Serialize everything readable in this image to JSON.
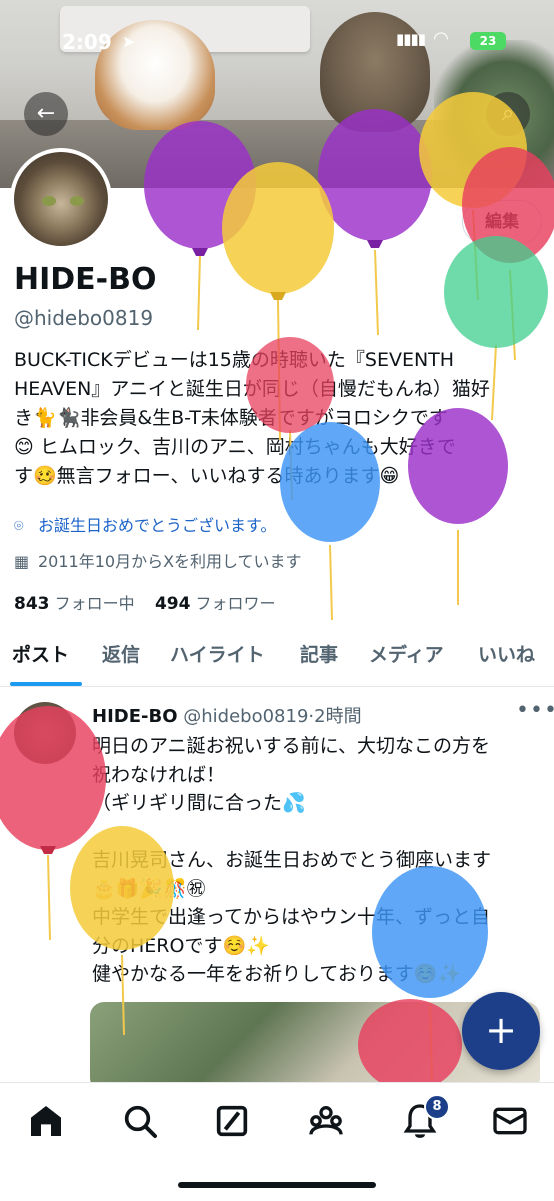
{
  "status_bar": {
    "time": "2:09",
    "battery": "23"
  },
  "profile": {
    "name": "HIDE-BO",
    "handle": "@hidebo0819",
    "edit_label": "編集",
    "bio": [
      "BUCK-TICKデビューは15歳の時聴いた『SEVENTH",
      "HEAVEN』アニイと誕生日が同じ（自慢だもんね）猫好",
      "き🐈🐈‍⬛非会員&生B-T未体験者ですがヨロシクです",
      "😊 ヒムロック、吉川のアニ、岡村ちゃんも大好きで",
      "す🥴無言フォロー、いいねする時あります😁"
    ],
    "birthday": "お誕生日おめでとうございます。",
    "joined": "2011年10月からXを利用しています",
    "following_count": "843",
    "following_label": "フォロー中",
    "followers_count": "494",
    "followers_label": "フォロワー"
  },
  "tabs": [
    "ポスト",
    "返信",
    "ハイライト",
    "記事",
    "メディア",
    "いいね"
  ],
  "post": {
    "name": "HIDE-BO",
    "handle": "@hidebo0819",
    "time": "·2時間",
    "lines": [
      "明日のアニ誕お祝いする前に、大切なこの方を",
      "祝わなければ！",
      "（ギリギリ間に合った💦",
      "",
      "吉川晃司さん、お誕生日おめでとう御座います",
      "🎂🎁🎉🎊㊗",
      "中学生で出逢ってからはやウン十年、ずっと自",
      "分のHEROです☺️✨",
      "健やかなる一年をお祈りしております☺️✨"
    ]
  },
  "notifications_badge": "8",
  "colors": {
    "accent": "#1d9bf0",
    "link": "#1d64c8",
    "fab": "#1d3f8a"
  },
  "icons": [
    "back-arrow-icon",
    "search-icon",
    "location-icon",
    "calendar-icon",
    "more-icon",
    "home-icon",
    "explore-icon",
    "grok-icon",
    "communities-icon",
    "bell-icon",
    "mail-icon",
    "plus-icon"
  ]
}
